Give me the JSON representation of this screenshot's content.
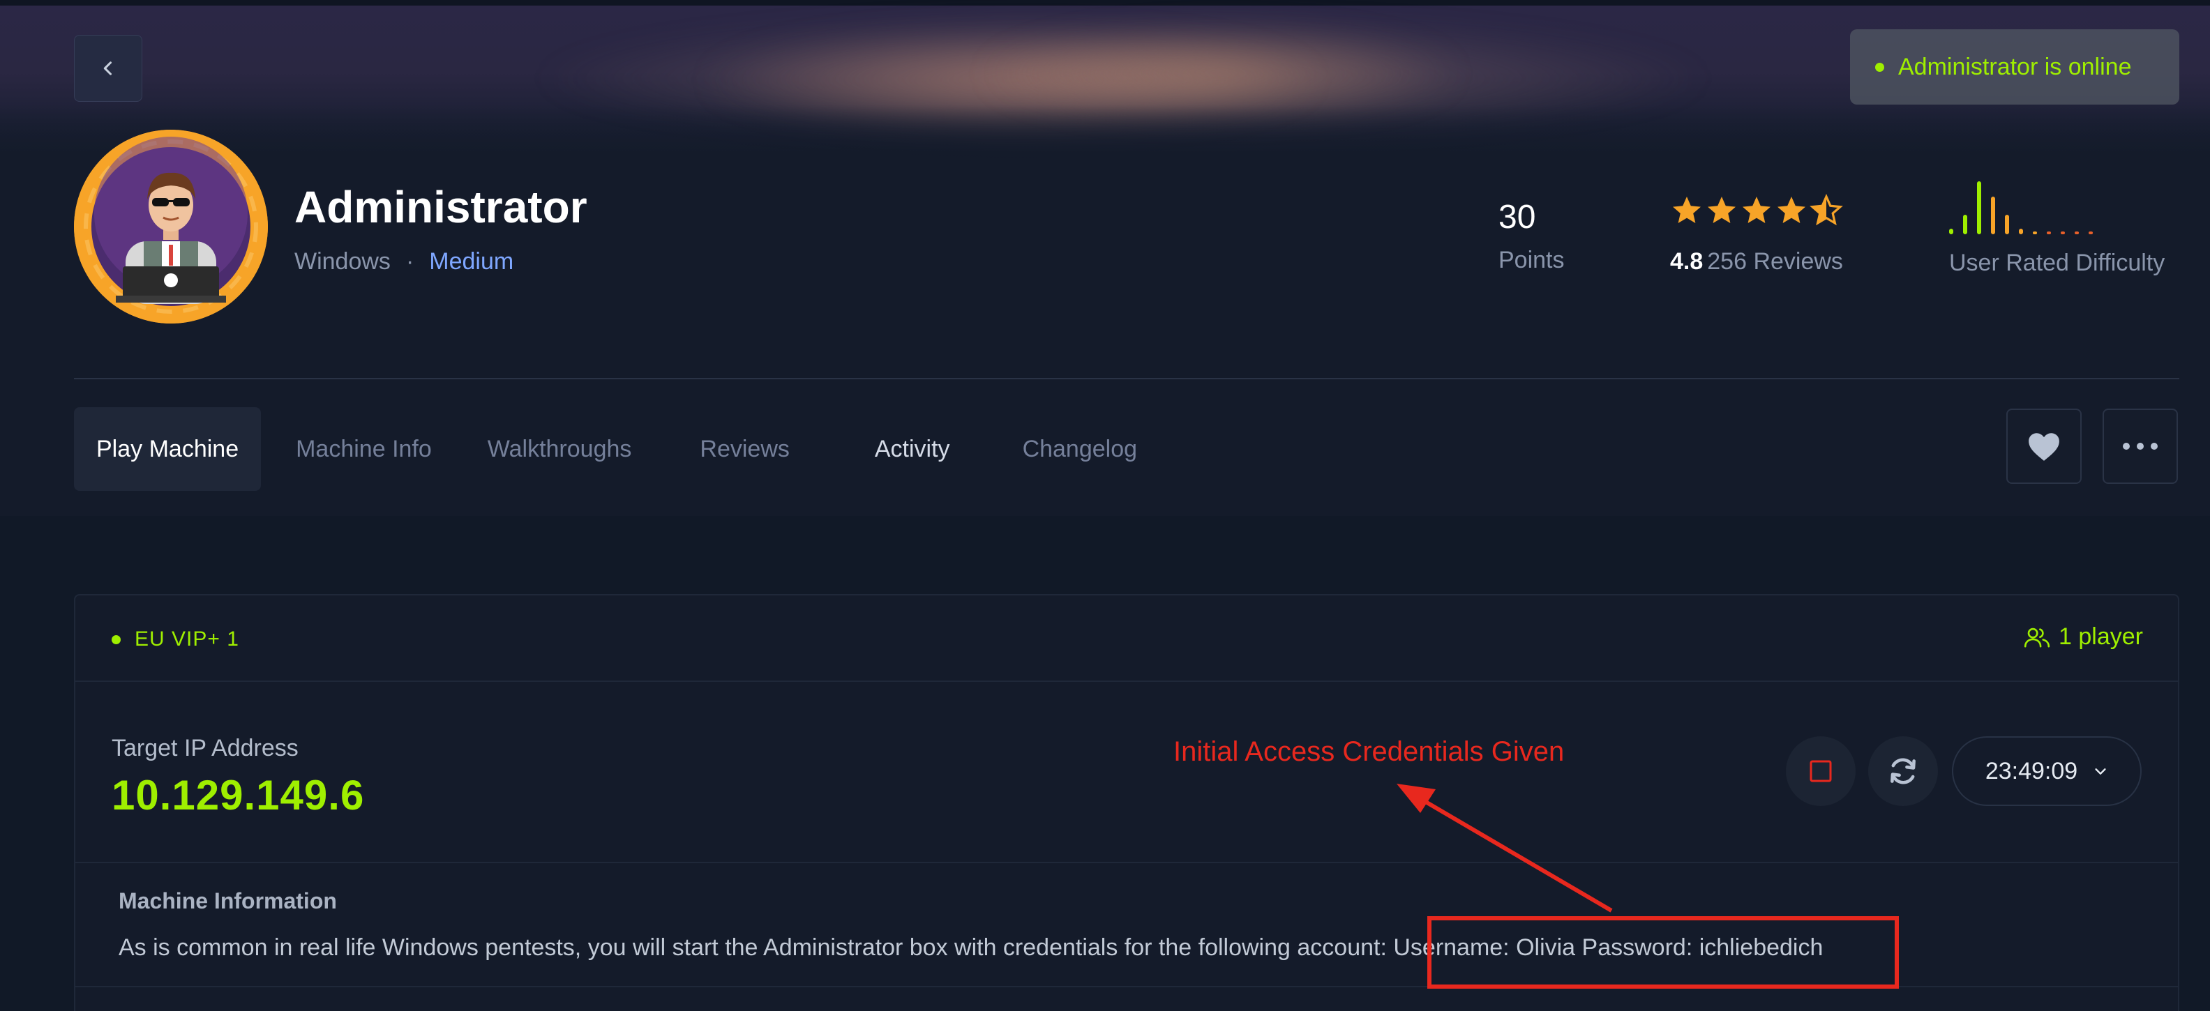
{
  "header": {
    "online_status": "Administrator is online",
    "colors": {
      "accent": "#9fef00",
      "difficulty": "#7fa7ff",
      "star": "#f7a428",
      "annotation": "#e8281e"
    }
  },
  "machine": {
    "name": "Administrator",
    "os": "Windows",
    "separator": "·",
    "difficulty": "Medium",
    "points_value": "30",
    "points_label": "Points",
    "rating_value": "4.8",
    "rating_stars": 4.5,
    "reviews_label": "256 Reviews",
    "difficulty_label": "User Rated Difficulty"
  },
  "tabs": [
    {
      "label": "Play Machine"
    },
    {
      "label": "Machine Info"
    },
    {
      "label": "Walkthroughs"
    },
    {
      "label": "Reviews"
    },
    {
      "label": "Activity"
    },
    {
      "label": "Changelog"
    }
  ],
  "card": {
    "server": "EU VIP+ 1",
    "players": "1 player",
    "ip_label": "Target IP Address",
    "ip_value": "10.129.149.6",
    "timer": "23:49:09",
    "info_label": "Machine Information",
    "info_text": "As is common in real life Windows pentests, you will start the Administrator box with credentials for the following account: Username: Olivia Password: ichliebedich"
  },
  "annotation": {
    "text": "Initial Access Credentials Given"
  },
  "icons": [
    "chevron-left-icon",
    "heart-icon",
    "more-horizontal-icon",
    "users-icon",
    "stop-icon",
    "refresh-icon",
    "chevron-down-icon",
    "star-icon"
  ]
}
